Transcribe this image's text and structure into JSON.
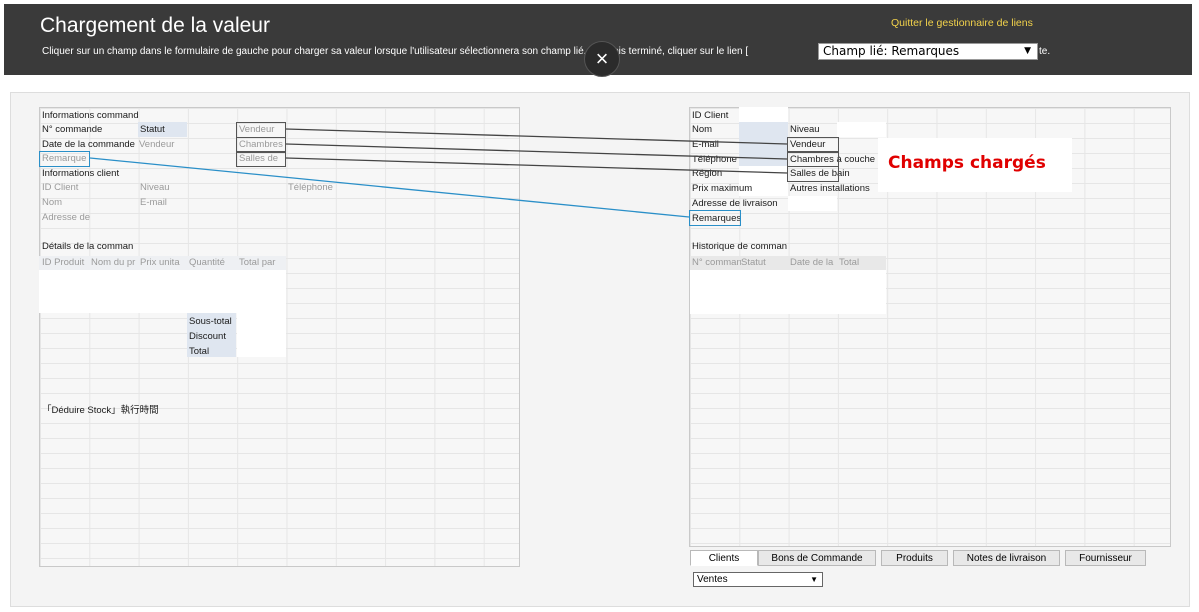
{
  "header": {
    "title": "Chargement de la valeur",
    "instruction_part1": "Cliquer sur un champ dans le formulaire de gauche pour charger sa valeur lorsque l'utilisateur sélectionnera son champ lié. Une fois terminé, cliquer sur le lien [",
    "instruction_part2": "te.",
    "quit_link": "Quitter le gestionnaire de liens",
    "linked_field_select": "Champ lié: Remarques",
    "close_symbol": "×"
  },
  "left_form": {
    "section_order": "Informations command",
    "order_no": "N° commande",
    "status": "Statut",
    "vendor": "Vendeur",
    "order_date": "Date de la commande",
    "vendor2": "Vendeur",
    "rooms": "Chambres",
    "remark": "Remarque",
    "bathrooms": "Salles de",
    "section_client": "Informations client",
    "client_id": "ID Client",
    "level": "Niveau",
    "phone": "Téléphone",
    "name": "Nom",
    "email": "E-mail",
    "address": "Adresse de",
    "section_details": "Détails de la comman",
    "col_product_id": "ID Produit",
    "col_product_name": "Nom du pr",
    "col_unit_price": "Prix unita",
    "col_quantity": "Quantité",
    "col_total_par": "Total par",
    "subtotal": "Sous-total",
    "discount": "Discount",
    "total": "Total",
    "stock_label": "「Déduire Stock」執行時間"
  },
  "right_form": {
    "client_id": "ID Client",
    "name": "Nom",
    "level": "Niveau",
    "email": "E-mail",
    "vendor": "Vendeur",
    "phone": "Téléphone",
    "bedrooms": "Chambres à couche",
    "region": "Région",
    "bathrooms": "Salles de bain",
    "max_price": "Prix maximum",
    "other_facilities": "Autres installations",
    "delivery_address": "Adresse de livraison",
    "remarks": "Remarques",
    "section_history": "Historique de comman",
    "col_order_no": "N° commande",
    "col_status": "Statut",
    "col_date": "Date de la",
    "col_total": "Total"
  },
  "annotation": "Champs chargés",
  "tabs": [
    {
      "label": "Clients",
      "active": true
    },
    {
      "label": "Bons de Commande",
      "active": false
    },
    {
      "label": "Produits",
      "active": false
    },
    {
      "label": "Notes de livraison",
      "active": false
    },
    {
      "label": "Fournisseur",
      "active": false
    }
  ],
  "view_select": "Ventes",
  "colors": {
    "header_bg": "#3a3a3a",
    "quit_link": "#f2d24b",
    "annotation": "#e00000",
    "link_line_active": "#2a8fc8",
    "link_line": "#444444"
  }
}
